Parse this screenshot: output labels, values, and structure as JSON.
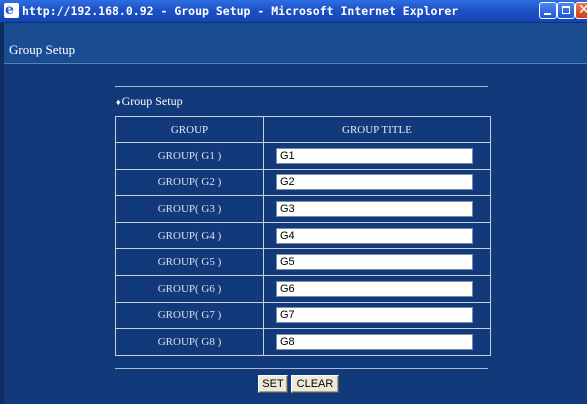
{
  "window": {
    "title": "http://192.168.0.92 - Group Setup - Microsoft Internet Explorer",
    "icon": "ie-icon",
    "controls": [
      "minimize-icon",
      "maximize-icon",
      "close-icon"
    ]
  },
  "page": {
    "header_title": "Group Setup",
    "section_title": "Group Setup",
    "section_marker": "♦"
  },
  "table": {
    "headers": [
      "GROUP",
      "GROUP TITLE"
    ],
    "rows": [
      {
        "label": "GROUP( G1 )",
        "value": "G1"
      },
      {
        "label": "GROUP( G2 )",
        "value": "G2"
      },
      {
        "label": "GROUP( G3 )",
        "value": "G3"
      },
      {
        "label": "GROUP( G4 )",
        "value": "G4"
      },
      {
        "label": "GROUP( G5 )",
        "value": "G5"
      },
      {
        "label": "GROUP( G6 )",
        "value": "G6"
      },
      {
        "label": "GROUP( G7 )",
        "value": "G7"
      },
      {
        "label": "GROUP( G8 )",
        "value": "G8"
      }
    ]
  },
  "buttons": {
    "set": "SET",
    "clear": "CLEAR"
  },
  "colors": {
    "background": "#123a7a",
    "header_band": "#1a4c92",
    "titlebar": "#1d52c6"
  }
}
